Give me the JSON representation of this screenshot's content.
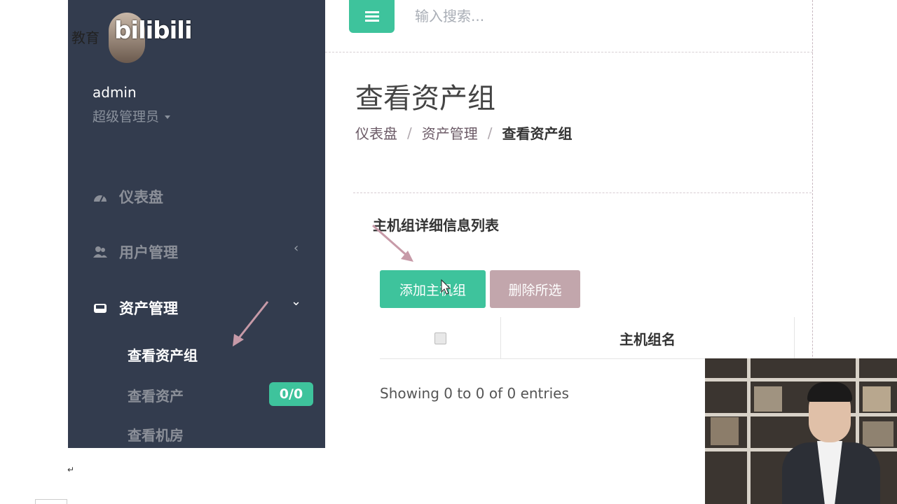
{
  "brand": {
    "text": "教育",
    "logo": "bilibili"
  },
  "user": {
    "name": "admin",
    "role": "超级管理员"
  },
  "sidebar": {
    "items": [
      {
        "label": "仪表盘",
        "icon": "dashboard-icon"
      },
      {
        "label": "用户管理",
        "icon": "users-icon",
        "chevron": "‹"
      },
      {
        "label": "资产管理",
        "icon": "inbox-icon",
        "chevron": "⌄"
      }
    ],
    "sub_items": [
      {
        "label": "查看资产组"
      },
      {
        "label": "查看资产",
        "badge": "0/0"
      },
      {
        "label": "查看机房"
      }
    ]
  },
  "search": {
    "placeholder": "输入搜索..."
  },
  "page": {
    "title": "查看资产组",
    "breadcrumb": [
      "仪表盘",
      "资产管理",
      "查看资产组"
    ]
  },
  "panel": {
    "title": "主机组详细信息列表",
    "add_button": "添加主机组",
    "delete_button": "删除所选",
    "table_header": "主机组名",
    "info": "Showing 0 to 0 of 0 entries"
  },
  "colors": {
    "sidebar": "#333c4e",
    "accent": "#3ec39c",
    "delete": "#c2a6ac",
    "annotation": "#c79aa8"
  }
}
